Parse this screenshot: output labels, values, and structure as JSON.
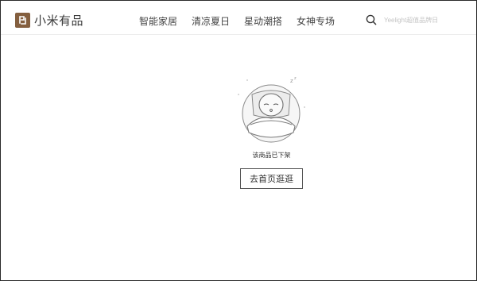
{
  "header": {
    "brand_name": "小米有品",
    "nav": [
      {
        "label": "智能家居"
      },
      {
        "label": "清凉夏日"
      },
      {
        "label": "星动潮搭"
      },
      {
        "label": "女神专场"
      }
    ],
    "search": {
      "placeholder": "Yeelight超值品牌日",
      "icon": "search-icon"
    }
  },
  "main": {
    "illustration_icon": "sleeping-face-icon",
    "message": "该商品已下架",
    "home_button_label": "去首页逛逛"
  },
  "colors": {
    "brand": "#845f3f",
    "border": "#2a2a2a",
    "divider": "#ececec"
  }
}
